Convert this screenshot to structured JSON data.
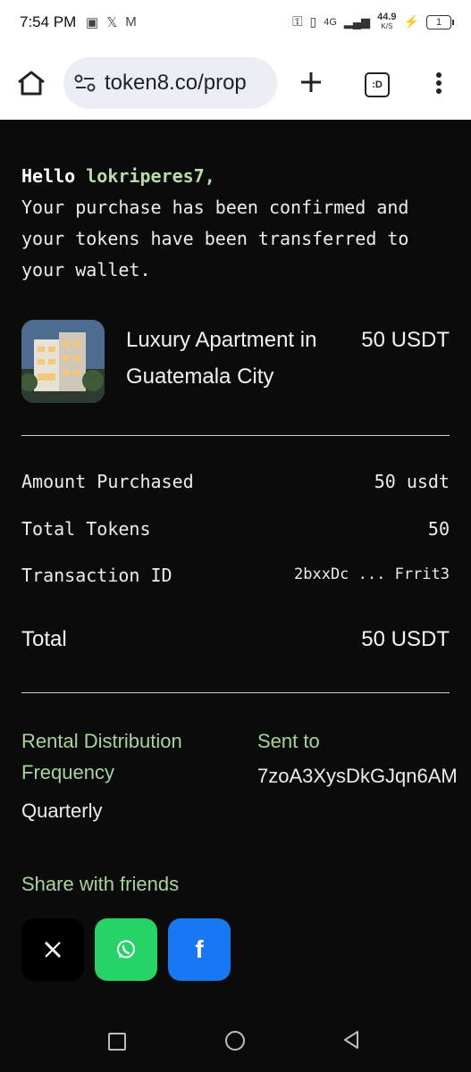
{
  "status_bar": {
    "time": "7:54 PM",
    "network": "4G",
    "speed": "44.9",
    "speed_unit": "K/S",
    "battery": "1"
  },
  "browser": {
    "url": "token8.co/prop",
    "tab_count": ":D"
  },
  "greeting": {
    "hello": "Hello",
    "username": "lokriperes7,",
    "message": "Your purchase has been confirmed and your tokens have been transferred to your wallet."
  },
  "product": {
    "name": "Luxury Apartment in Guatemala City",
    "price": "50 USDT"
  },
  "details": [
    {
      "label": "Amount Purchased",
      "value": "50 usdt"
    },
    {
      "label": "Total Tokens",
      "value": "50"
    },
    {
      "label": "Transaction ID",
      "value": "2bxxDc ... Frrit3"
    }
  ],
  "total": {
    "label": "Total",
    "value": "50 USDT"
  },
  "rental": {
    "label": "Rental Distribution Frequency",
    "value": "Quarterly"
  },
  "sent": {
    "label": "Sent to",
    "value": "7zoA3XysDkGJqn6AM"
  },
  "share": {
    "label": "Share with friends",
    "buttons": [
      "x-share",
      "whatsapp-share",
      "facebook-share"
    ]
  },
  "colors": {
    "background": "#0b0b0b",
    "accent_green": "#a7d49b",
    "whatsapp": "#25d366",
    "facebook": "#1877f2"
  }
}
